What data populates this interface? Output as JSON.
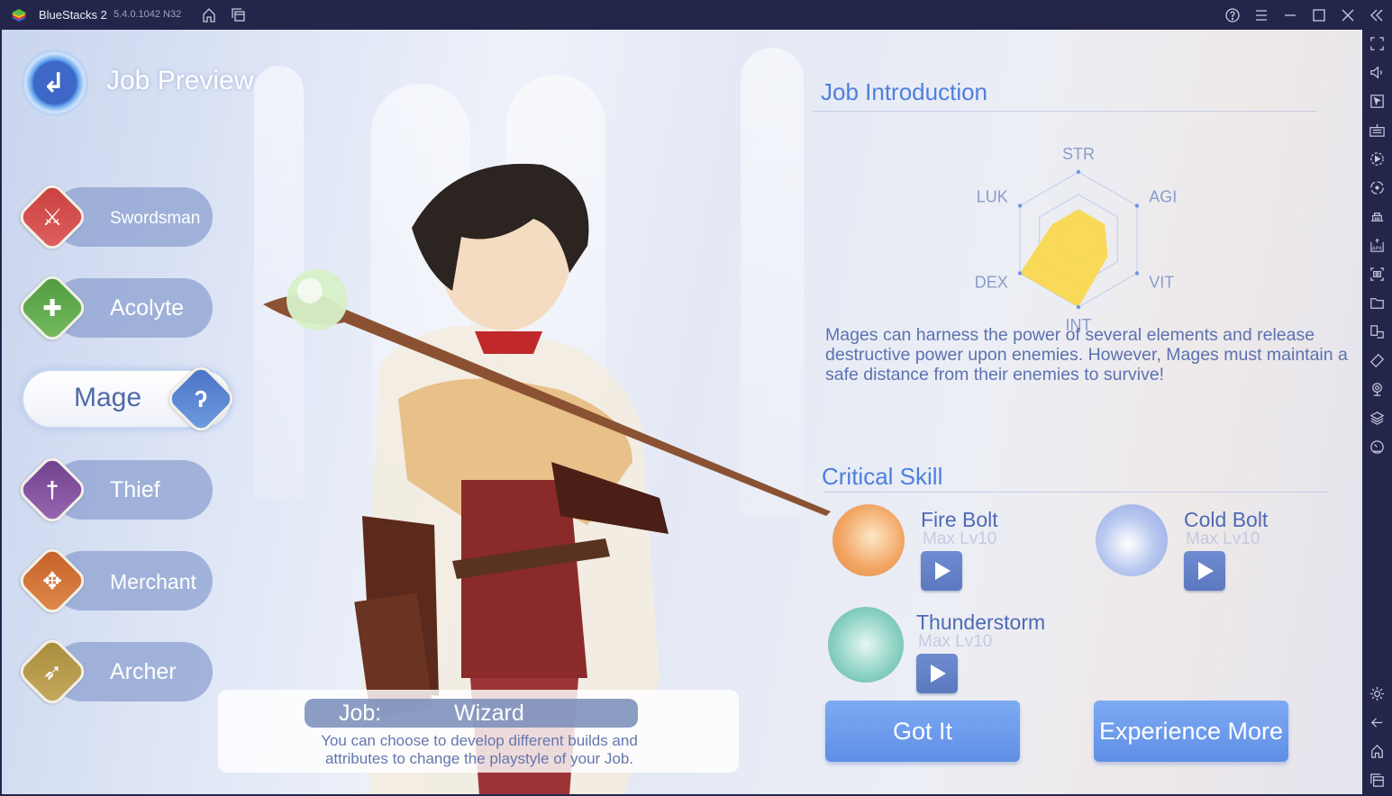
{
  "window": {
    "app_name": "BlueStacks 2",
    "version": "5.4.0.1042 N32",
    "titlebar_icons": [
      "home-icon",
      "multi-instance-icon",
      "help-icon",
      "menu-icon",
      "minimize-icon",
      "maximize-icon",
      "close-icon",
      "collapse-sidebar-icon"
    ]
  },
  "right_sidebar": {
    "icons": [
      "fullscreen-icon",
      "volume-icon",
      "pointer-icon",
      "keyboard-icon",
      "macro-record-icon",
      "rotate-sync-icon",
      "shop-icon",
      "apk-install-icon",
      "screenshot-icon",
      "folder-icon",
      "multi-window-icon",
      "shake-icon",
      "location-icon",
      "layers-icon",
      "performance-icon"
    ],
    "bottom_icons": [
      "settings-icon",
      "back-icon",
      "home-icon",
      "recent-apps-icon"
    ]
  },
  "header": {
    "title": "Job Preview",
    "back_icon": "back-arrow-icon"
  },
  "jobs": [
    {
      "label": "Swordsman",
      "icon": "sword-icon",
      "color": "#d24a47",
      "selected": false
    },
    {
      "label": "Acolyte",
      "icon": "cross-icon",
      "color": "#5fa94e",
      "selected": false
    },
    {
      "label": "Mage",
      "icon": "staff-icon",
      "color": "#4f7bd0",
      "selected": true
    },
    {
      "label": "Thief",
      "icon": "dagger-icon",
      "color": "#7f4d9a",
      "selected": false
    },
    {
      "label": "Merchant",
      "icon": "axe-icon",
      "color": "#d06d33",
      "selected": false
    },
    {
      "label": "Archer",
      "icon": "bow-icon",
      "color": "#b89a48",
      "selected": false
    }
  ],
  "info_card": {
    "job_label": "Job:",
    "job_value": "Wizard",
    "description": "You can choose to develop different builds and attributes to change the playstyle of your Job."
  },
  "job_intro": {
    "title": "Job Introduction",
    "description": "Mages can harness the power of several elements and release destructive power upon enemies. However, Mages must maintain a safe distance from their enemies to survive!"
  },
  "chart_data": {
    "type": "radar",
    "axes": [
      "STR",
      "AGI",
      "VIT",
      "INT",
      "DEX",
      "LUK"
    ],
    "values": [
      0.45,
      0.45,
      0.5,
      1.0,
      1.0,
      0.45
    ],
    "range": [
      0,
      1
    ],
    "rings": 3,
    "fill_color": "#f9d84f"
  },
  "critical_skill": {
    "title": "Critical Skill",
    "skills": [
      {
        "name": "Fire Bolt",
        "level": "Max Lv10",
        "icon": "fire-bolt-icon"
      },
      {
        "name": "Cold Bolt",
        "level": "Max Lv10",
        "icon": "cold-bolt-icon"
      },
      {
        "name": "Thunderstorm",
        "level": "Max Lv10",
        "icon": "thunderstorm-icon"
      }
    ]
  },
  "buttons": {
    "got_it": "Got It",
    "experience_more": "Experience More"
  }
}
